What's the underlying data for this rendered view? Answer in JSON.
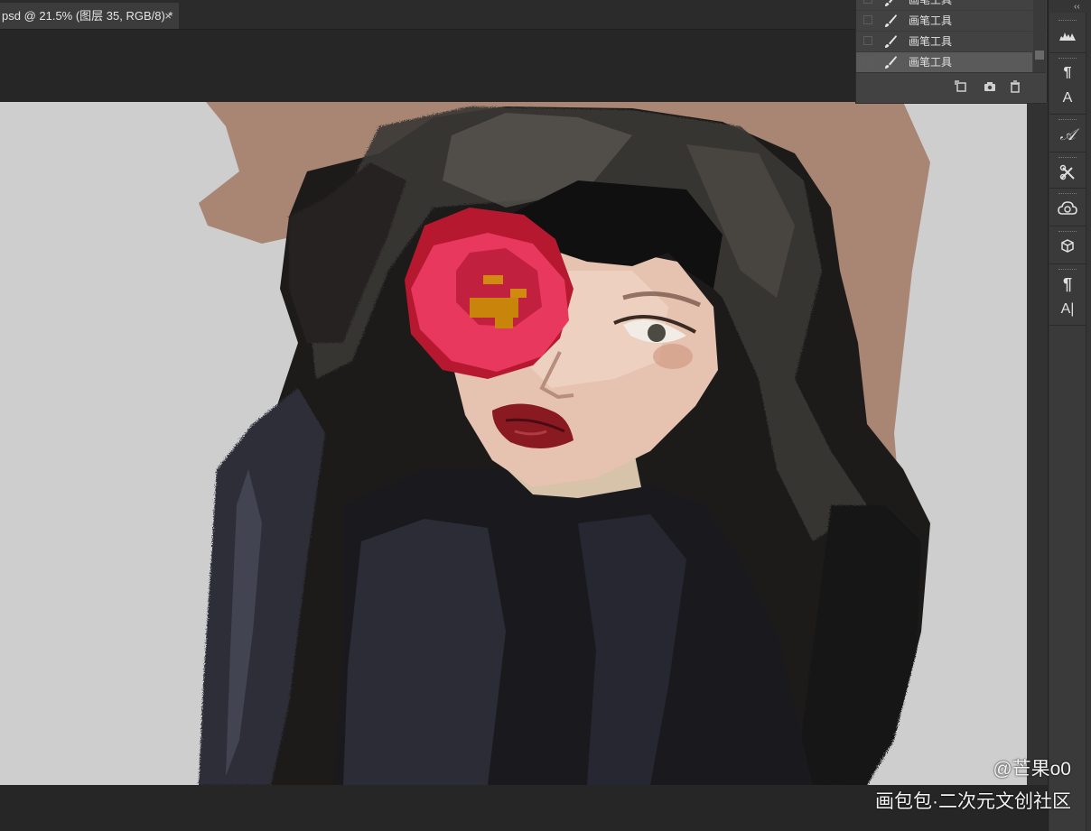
{
  "document_tab": {
    "title": "psd @ 21.5% (图层 35, RGB/8) *",
    "close": "×"
  },
  "history": {
    "items": [
      {
        "label": "画笔工具",
        "active": false
      },
      {
        "label": "画笔工具",
        "active": false
      },
      {
        "label": "画笔工具",
        "active": false
      },
      {
        "label": "画笔工具",
        "active": true
      }
    ]
  },
  "dock": {
    "collapse": "‹‹",
    "tools": [
      {
        "name": "histogram-icon",
        "glyph": ""
      },
      {
        "name": "paragraph-styles-icon",
        "glyph": "¶"
      },
      {
        "name": "character-styles-icon",
        "glyph": "A"
      },
      {
        "name": "glyphs-icon",
        "glyph": "𝒜"
      },
      {
        "name": "tool-presets-icon",
        "glyph": ""
      },
      {
        "name": "libraries-icon",
        "glyph": ""
      },
      {
        "name": "3d-icon",
        "glyph": ""
      },
      {
        "name": "paragraph-icon",
        "glyph": "¶"
      },
      {
        "name": "character-icon",
        "glyph": "A|"
      }
    ]
  },
  "watermark": {
    "author": "@芒果o0",
    "site": "画包包·二次元文创社区"
  },
  "colors": {
    "canvas_bg": "#cecece",
    "panel_bg": "#424242",
    "active_row": "#5a5a5a",
    "app_bg": "#282828"
  }
}
